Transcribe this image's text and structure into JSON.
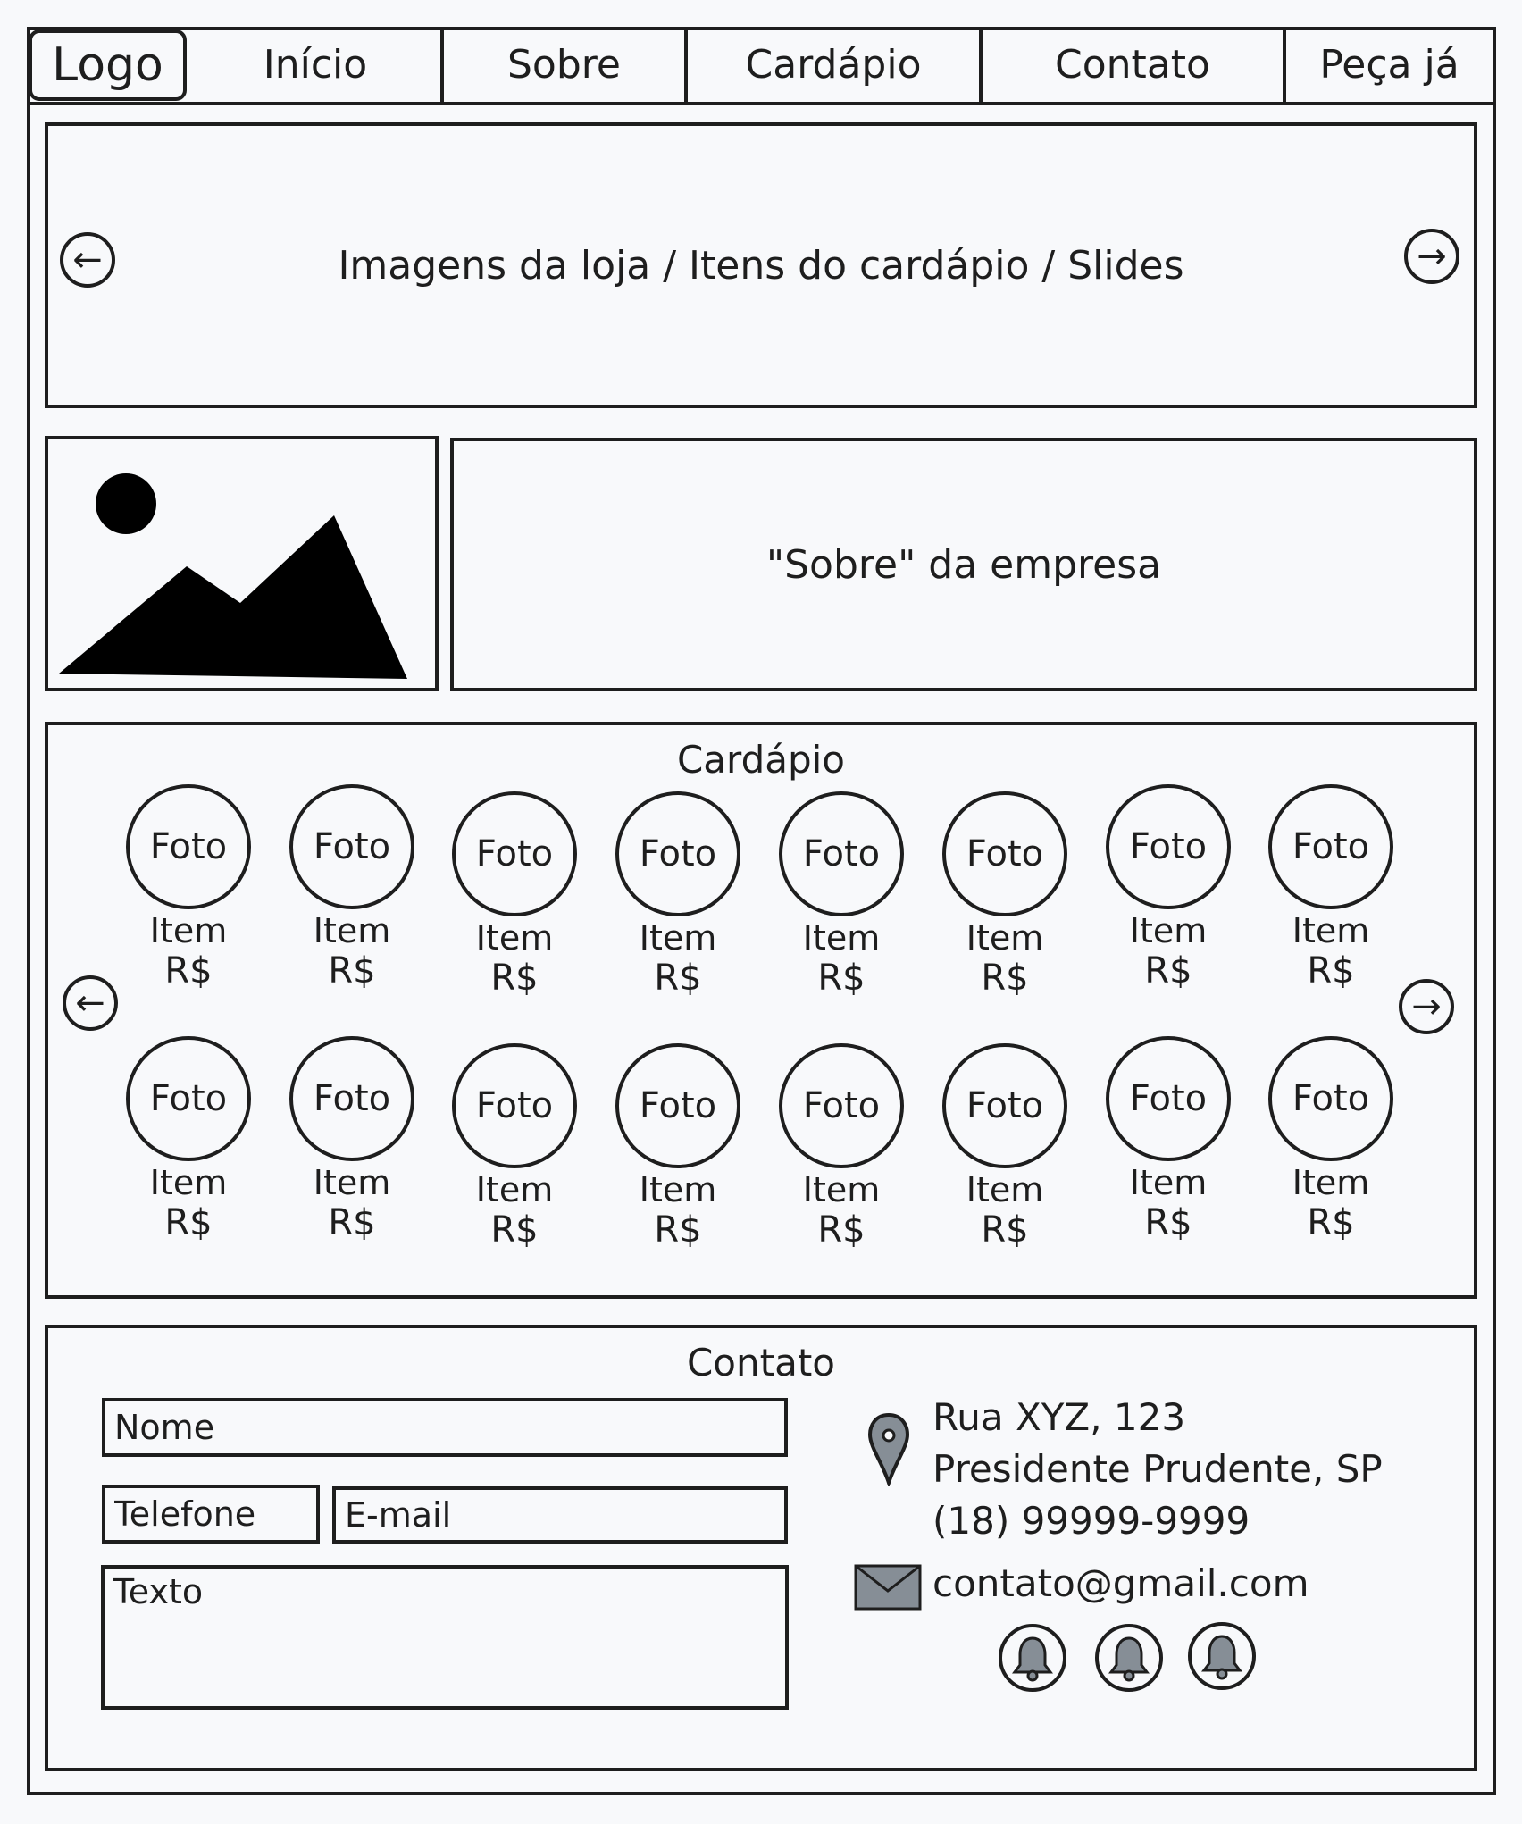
{
  "nav": {
    "logo": "Logo",
    "items": [
      "Início",
      "Sobre",
      "Cardápio",
      "Contato",
      "Peça já"
    ]
  },
  "hero": {
    "text": "Imagens da loja / Itens do cardápio / Slides",
    "prev_icon": "arrow-left-icon",
    "next_icon": "arrow-right-icon"
  },
  "about": {
    "image_icon": "image-placeholder-icon",
    "text": "\"Sobre\" da empresa"
  },
  "menu": {
    "title": "Cardápio",
    "photo_label": "Foto",
    "item_label": "Item",
    "price_label": "R$",
    "columns": 8,
    "rows": 2
  },
  "contact": {
    "title": "Contato",
    "form": {
      "name_placeholder": "Nome",
      "phone_placeholder": "Telefone",
      "email_placeholder": "E-mail",
      "text_placeholder": "Texto"
    },
    "address_line1": "Rua XYZ, 123",
    "address_line2": "Presidente Prudente, SP",
    "phone": "(18) 99999-9999",
    "email": "contato@gmail.com",
    "social_icons": [
      "bell-icon",
      "bell-icon",
      "bell-icon"
    ],
    "colors": {
      "icon_fill": "#868e96"
    }
  }
}
